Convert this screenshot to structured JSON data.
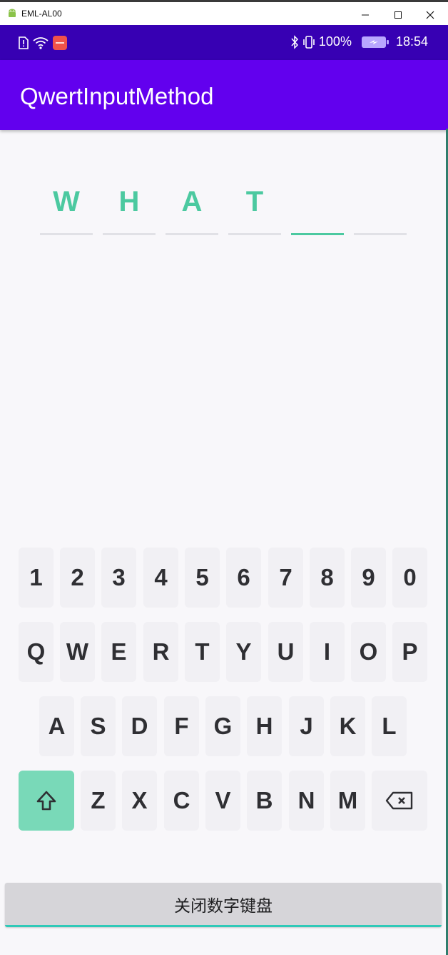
{
  "window": {
    "title": "EML-AL00"
  },
  "status_bar": {
    "battery_text": "100%",
    "time": "18:54"
  },
  "app_bar": {
    "title": "QwertInputMethod"
  },
  "code_input": {
    "cells": [
      "W",
      "H",
      "A",
      "T",
      "",
      ""
    ],
    "active_index": 4
  },
  "keyboard": {
    "row1": [
      "1",
      "2",
      "3",
      "4",
      "5",
      "6",
      "7",
      "8",
      "9",
      "0"
    ],
    "row2": [
      "Q",
      "W",
      "E",
      "R",
      "T",
      "Y",
      "U",
      "I",
      "O",
      "P"
    ],
    "row3": [
      "A",
      "S",
      "D",
      "F",
      "G",
      "H",
      "J",
      "K",
      "L"
    ],
    "row4": [
      "Z",
      "X",
      "C",
      "V",
      "B",
      "N",
      "M"
    ]
  },
  "bottom": {
    "close_label": "关闭数字键盘"
  },
  "colors": {
    "accent": "#4cc9a0",
    "app_bar": "#6200ee",
    "status_bar": "#3700b3",
    "shift": "#79d9b8"
  },
  "icons": {
    "shift": "shift-arrow-icon",
    "backspace": "backspace-icon"
  }
}
